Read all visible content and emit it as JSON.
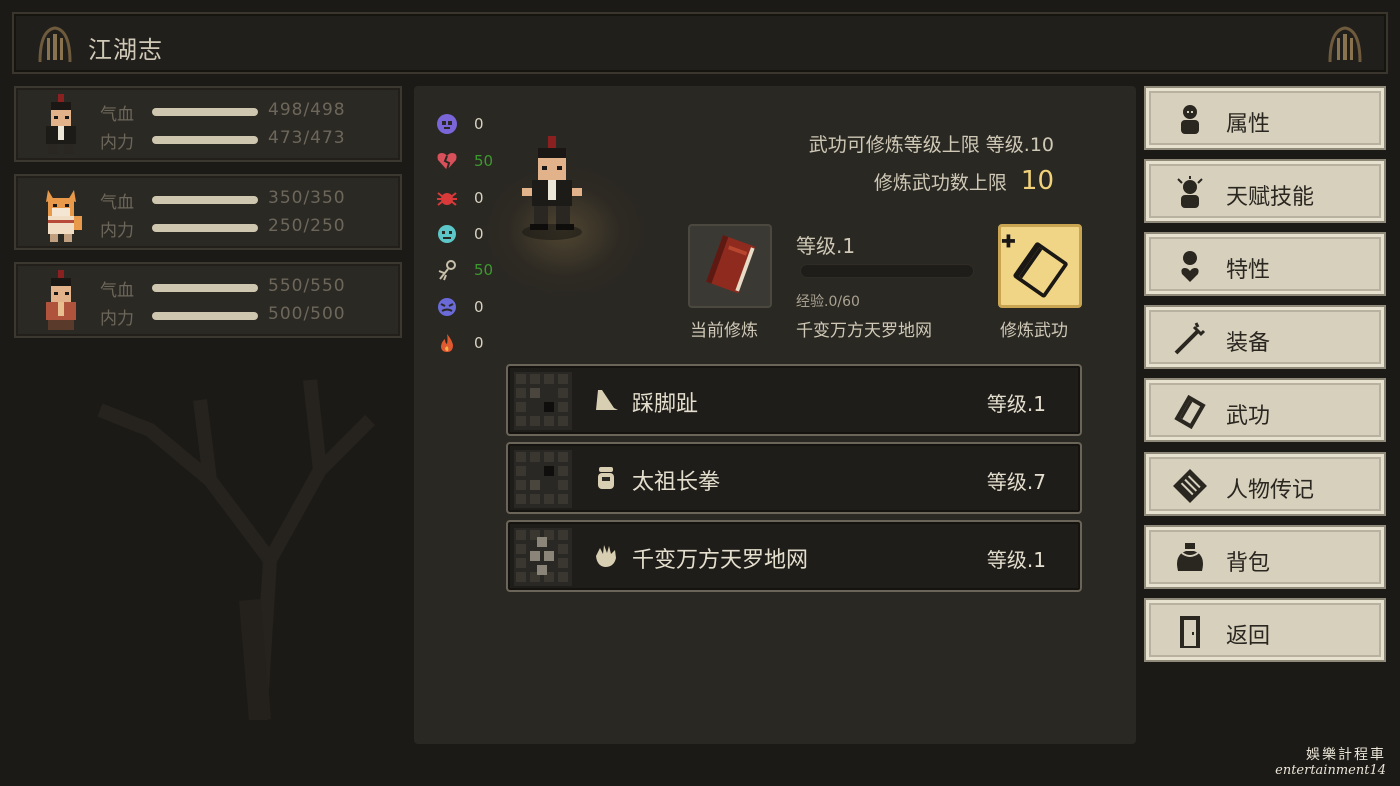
{
  "title": "江湖志",
  "party": [
    {
      "hp_label": "气血",
      "mp_label": "内力",
      "hp": "498/498",
      "mp": "473/473"
    },
    {
      "hp_label": "气血",
      "mp_label": "内力",
      "hp": "350/350",
      "mp": "250/250"
    },
    {
      "hp_label": "气血",
      "mp_label": "内力",
      "hp": "550/550",
      "mp": "500/500"
    }
  ],
  "resistances": [
    {
      "icon": "skull-icon",
      "value": "0",
      "color": "#7a66d8"
    },
    {
      "icon": "broken-heart-icon",
      "value": "50",
      "color": "#d8505a"
    },
    {
      "icon": "spider-icon",
      "value": "0",
      "color": "#d83a3a"
    },
    {
      "icon": "frost-face-icon",
      "value": "0",
      "color": "#5cc6c8"
    },
    {
      "icon": "stun-icon",
      "value": "50",
      "color": "#c8c0aa"
    },
    {
      "icon": "dizzy-face-icon",
      "value": "0",
      "color": "#6a6ad8"
    },
    {
      "icon": "flame-icon",
      "value": "0",
      "color": "#e05a30"
    }
  ],
  "info": {
    "max_level_label": "武功可修炼等级上限",
    "max_level_value": "等级.10",
    "max_count_label": "修炼武功数上限",
    "max_count_value": "10"
  },
  "current": {
    "slot_label": "当前修炼",
    "level": "等级.1",
    "exp_text": "经验.0/60",
    "exp_fraction": 0,
    "skill_name": "千变万方天罗地网",
    "train_label": "修炼武功"
  },
  "skills": [
    {
      "icon": "kick-icon",
      "name": "踩脚趾",
      "level": "等级.1"
    },
    {
      "icon": "fist-icon",
      "name": "太祖长拳",
      "level": "等级.7"
    },
    {
      "icon": "palm-icon",
      "name": "千变万方天罗地网",
      "level": "等级.1"
    }
  ],
  "menu": [
    {
      "icon": "attributes-icon",
      "label": "属性"
    },
    {
      "icon": "talent-skill-icon",
      "label": "天赋技能"
    },
    {
      "icon": "trait-icon",
      "label": "特性"
    },
    {
      "icon": "equipment-icon",
      "label": "装备"
    },
    {
      "icon": "martial-arts-icon",
      "label": "武功"
    },
    {
      "icon": "biography-icon",
      "label": "人物传记"
    },
    {
      "icon": "bag-icon",
      "label": "背包"
    },
    {
      "icon": "return-icon",
      "label": "返回"
    }
  ],
  "watermark": {
    "line1": "娛樂計程車",
    "line2": "entertainment14"
  }
}
